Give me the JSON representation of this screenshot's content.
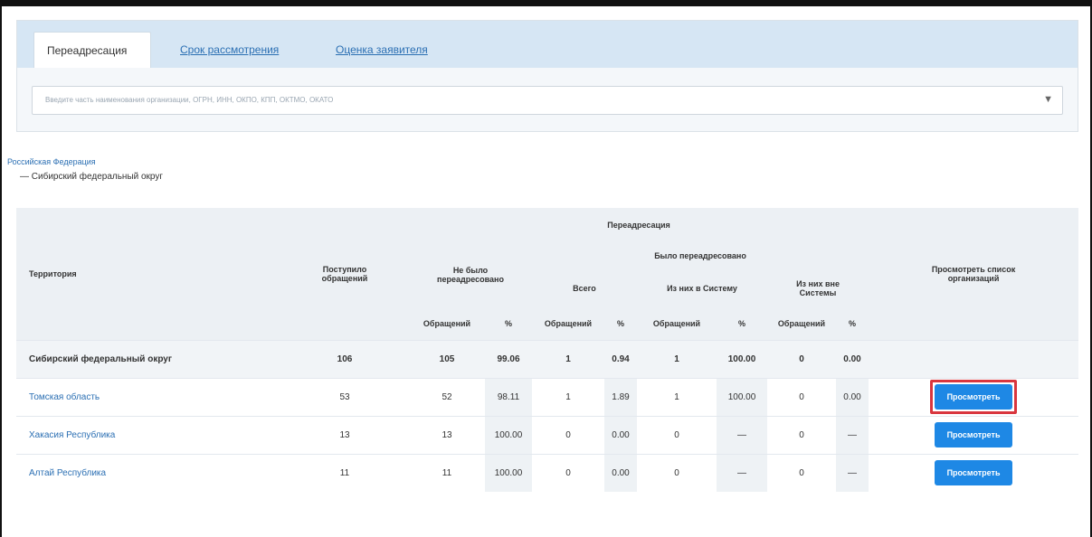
{
  "tabs": [
    {
      "label": "Переадресация",
      "active": true
    },
    {
      "label": "Срок рассмотрения",
      "active": false
    },
    {
      "label": "Оценка заявителя",
      "active": false
    }
  ],
  "search": {
    "placeholder": "Введите часть наименования организации, ОГРН, ИНН, ОКПО, КПП, ОКТМО, ОКАТО",
    "caret": "▼"
  },
  "breadcrumb": {
    "root": "Российская Федерация",
    "current": "— Сибирский федеральный округ"
  },
  "table": {
    "headers": {
      "territory": "Территория",
      "received": "Поступило обращений",
      "not_redirected": "Не было переадресовано",
      "redirection": "Переадресация",
      "redirected": "Было переадресовано",
      "total": "Всего",
      "in_system": "Из них в Систему",
      "outside_system": "Из них вне Системы",
      "view_orgs": "Просмотреть список организаций",
      "sub_requests": "Обращений",
      "sub_percent": "%"
    },
    "rows": [
      {
        "territory": "Сибирский федеральный округ",
        "received": "106",
        "nr_count": "105",
        "nr_pct": "99.06",
        "total_count": "1",
        "total_pct": "0.94",
        "in_count": "1",
        "in_pct": "100.00",
        "out_count": "0",
        "out_pct": "0.00",
        "is_total": true,
        "button": ""
      },
      {
        "territory": "Томская область",
        "received": "53",
        "nr_count": "52",
        "nr_pct": "98.11",
        "total_count": "1",
        "total_pct": "1.89",
        "in_count": "1",
        "in_pct": "100.00",
        "out_count": "0",
        "out_pct": "0.00",
        "is_total": false,
        "button": "Просмотреть",
        "highlighted": true
      },
      {
        "territory": "Хакасия Республика",
        "received": "13",
        "nr_count": "13",
        "nr_pct": "100.00",
        "total_count": "0",
        "total_pct": "0.00",
        "in_count": "0",
        "in_pct": "—",
        "out_count": "0",
        "out_pct": "—",
        "is_total": false,
        "button": "Просмотреть"
      },
      {
        "territory": "Алтай Республика",
        "received": "11",
        "nr_count": "11",
        "nr_pct": "100.00",
        "total_count": "0",
        "total_pct": "0.00",
        "in_count": "0",
        "in_pct": "—",
        "out_count": "0",
        "out_pct": "—",
        "is_total": false,
        "button": "Просмотреть"
      }
    ]
  },
  "colors": {
    "accent": "#1e88e5",
    "link": "#2b6fb3",
    "highlight": "#d9363e",
    "tabbar": "#d6e6f4"
  }
}
